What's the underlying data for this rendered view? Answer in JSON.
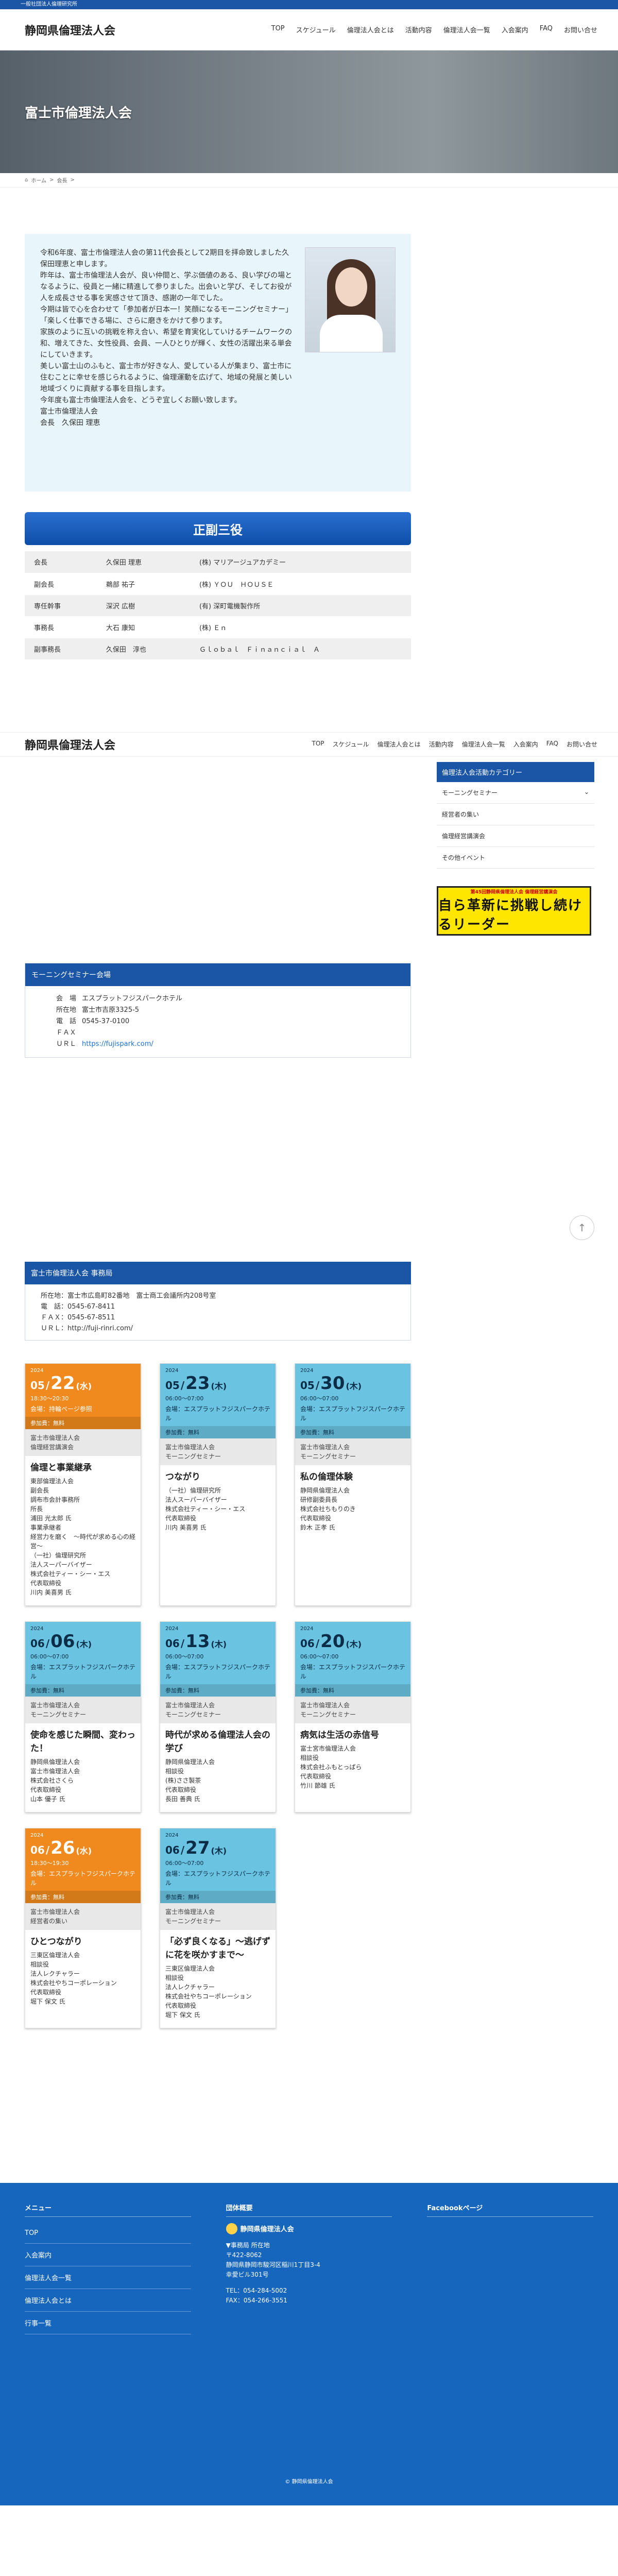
{
  "topbar": {
    "text": "一般社団法人倫理研究所"
  },
  "site": {
    "logo": "静岡県倫理法人会"
  },
  "nav": [
    "TOP",
    "スケジュール",
    "倫理法人会とは",
    "活動内容",
    "倫理法人会一覧",
    "入会案内",
    "FAQ",
    "お問い合せ"
  ],
  "hero": {
    "title": "富士市倫理法人会"
  },
  "breadcrumb": {
    "home": "ホーム",
    "sep": ">",
    "current": "会長"
  },
  "greeting": {
    "lines": [
      "令和6年度、富士市倫理法人会の第11代会長として2期目を拝命致しました久保田理恵と申します。",
      "昨年は、富士市倫理法人会が、良い仲間と、学ぶ価値のある、良い学びの場となるように、役員と一緒に精進して参りました。出会いと学び、そしてお役が人を成長させる事を実感させて頂き、感謝の一年でした。",
      "今期は皆で心を合わせて「参加者が日本一！笑顔になるモーニングセミナー」「楽しく仕事できる場に、さらに磨きをかけて参ります。",
      "家族のように互いの挑戦を称え合い、希望を育実化していけるチームワークの和、増えてきた、女性役員、会員、一人ひとりが輝く、女性の活躍出来る単会にしていきます。",
      "美しい富士山のふもと、富士市が好きな人、愛している人が集まり、富士市に住むことに幸せを感じられるように、倫理運動を広げて、地域の発展と美しい地域づくりに貢献する事を目指します。",
      "今年度も富士市倫理法人会を、どうぞ宜しくお願い致します。",
      "富士市倫理法人会",
      "会長　久保田 理恵"
    ]
  },
  "officers": {
    "banner": "正副三役",
    "rows": [
      {
        "role": "会長",
        "name": "久保田 理恵",
        "company": "(株) マリアージュアカデミー"
      },
      {
        "role": "副会長",
        "name": "鵜部 祐子",
        "company": "(株) ＹＯＵ　ＨＯＵＳＥ"
      },
      {
        "role": "専任幹事",
        "name": "深沢 広樹",
        "company": "(有) 深町電機製作所"
      },
      {
        "role": "事務長",
        "name": "大石 康知",
        "company": "(株) Ｅｎ"
      },
      {
        "role": "副事務長",
        "name": "久保田　淳也",
        "company": "Ｇｌｏｂａｌ　Ｆｉｎａｎｃｉａｌ　Ａ"
      }
    ]
  },
  "sidebar": {
    "title": "倫理法人会活動カテゴリー",
    "items": [
      "モーニングセミナー",
      "経営者の集い",
      "倫理経営講演会",
      "その他イベント"
    ],
    "banner_small": "第45回静岡県倫理法人会 倫理経営講演会",
    "banner_big": "自ら革新に挑戦し続けるリーダー"
  },
  "venue": {
    "title": "モーニングセミナー会場",
    "rows": [
      {
        "k": "会　場",
        "v": "エスプラットフジスパークホテル"
      },
      {
        "k": "所在地",
        "v": "富士市吉原3325-5"
      },
      {
        "k": "電　話",
        "v": "0545-37-0100"
      },
      {
        "k": "ＦＡＸ",
        "v": ""
      },
      {
        "k": "ＵＲＬ",
        "v": "https://fujispark.com/"
      }
    ]
  },
  "office": {
    "title": "富士市倫理法人会 事務局",
    "lines": [
      "所在地：富士市広島町82番地　富士商工会議所内208号室",
      "電　話：0545-67-8411",
      "ＦＡＸ：0545-67-8511",
      "ＵＲＬ：http://fuji-rinri.com/"
    ]
  },
  "events": [
    {
      "year": "2024",
      "month": "05",
      "day": "22",
      "wd": "(水)",
      "time": "18:30～20:30",
      "place": "会場：持輪ページ参照",
      "fee": "参加費：無料",
      "color": "#f08a1e",
      "cat1": "富士市倫理法人会",
      "cat2": "倫理経営講演会",
      "title": "倫理と事業継承",
      "body": [
        "東部倫理法人会",
        "副会長",
        "調布市会計事務所",
        "所長",
        "浦田 光太郎 氏",
        "事業承継者",
        "経営力を磨く　～時代が求める心の経営～",
        "（一社）倫理研究所",
        "法人スーパーバイザー",
        "株式会社ティー・シー・エス",
        "代表取締役",
        "川内 美喜男 氏"
      ]
    },
    {
      "year": "2024",
      "month": "05",
      "day": "23",
      "wd": "(木)",
      "time": "06:00～07:00",
      "place": "会場：エスプラットフジスパークホテル",
      "fee": "参加費：無料",
      "color": "#6ac3e0",
      "cat1": "富士市倫理法人会",
      "cat2": "モーニングセミナー",
      "title": "つながり",
      "body": [
        "（一社）倫理研究所",
        "法人スーパーバイザー",
        "株式会社ティー・シー・エス",
        "代表取締役",
        "川内 美喜男 氏"
      ]
    },
    {
      "year": "2024",
      "month": "05",
      "day": "30",
      "wd": "(木)",
      "time": "06:00～07:00",
      "place": "会場：エスプラットフジスパークホテル",
      "fee": "参加費：無料",
      "color": "#6ac3e0",
      "cat1": "富士市倫理法人会",
      "cat2": "モーニングセミナー",
      "title": "私の倫理体験",
      "body": [
        "静岡県倫理法人会",
        "研修副委員長",
        "株式会社ちもりのき",
        "代表取締役",
        "鈴木 正孝 氏"
      ]
    },
    {
      "year": "2024",
      "month": "06",
      "day": "06",
      "wd": "(木)",
      "time": "06:00～07:00",
      "place": "会場：エスプラットフジスパークホテル",
      "fee": "参加費：無料",
      "color": "#6ac3e0",
      "cat1": "富士市倫理法人会",
      "cat2": "モーニングセミナー",
      "title": "使命を感じた瞬間、変わった！",
      "body": [
        "静岡県倫理法人会",
        "富士市倫理法人会",
        "株式会社さくら",
        "代表取締役",
        "山本 優子 氏"
      ]
    },
    {
      "year": "2024",
      "month": "06",
      "day": "13",
      "wd": "(木)",
      "time": "06:00～07:00",
      "place": "会場：エスプラットフジスパークホテル",
      "fee": "参加費：無料",
      "color": "#6ac3e0",
      "cat1": "富士市倫理法人会",
      "cat2": "モーニングセミナー",
      "title": "時代が求める倫理法人会の学び",
      "body": [
        "静岡県倫理法人会",
        "相談役",
        "(株)ささ製茶",
        "代表取締役",
        "長田 善典 氏"
      ]
    },
    {
      "year": "2024",
      "month": "06",
      "day": "20",
      "wd": "(木)",
      "time": "06:00～07:00",
      "place": "会場：エスプラットフジスパークホテル",
      "fee": "参加費：無料",
      "color": "#6ac3e0",
      "cat1": "富士市倫理法人会",
      "cat2": "モーニングセミナー",
      "title": "病気は生活の赤信号",
      "body": [
        "富士宮市倫理法人会",
        "相談役",
        "株式会社ふもとっぱら",
        "代表取締役",
        "竹川 節雄 氏"
      ]
    },
    {
      "year": "2024",
      "month": "06",
      "day": "26",
      "wd": "(水)",
      "time": "18:30～19:30",
      "place": "会場：エスプラットフジスパークホテル",
      "fee": "参加費：無料",
      "color": "#f08a1e",
      "cat1": "富士市倫理法人会",
      "cat2": "経営者の集い",
      "title": "ひとつながり",
      "body": [
        "三東区倫理法人会",
        "相談役",
        "法人レクチャラー",
        "株式会社やちコーポレーション",
        "代表取締役",
        "堀下 保文 氏"
      ]
    },
    {
      "year": "2024",
      "month": "06",
      "day": "27",
      "wd": "(木)",
      "time": "06:00～07:00",
      "place": "会場：エスプラットフジスパークホテル",
      "fee": "参加費：無料",
      "color": "#6ac3e0",
      "cat1": "富士市倫理法人会",
      "cat2": "モーニングセミナー",
      "title": "「必ず良くなる」～逃げずに花を咲かすまで～",
      "body": [
        "三東区倫理法人会",
        "相談役",
        "法人レクチャラー",
        "株式会社やちコーポレーション",
        "代表取締役",
        "堀下 保文 氏"
      ]
    }
  ],
  "footer": {
    "menu_title": "メニュー",
    "menu": [
      "TOP",
      "入会案内",
      "倫理法人会一覧",
      "倫理法人会とは",
      "行事一覧"
    ],
    "info_title": "団体概要",
    "org_name": "静岡県倫理法人会",
    "org_lines": [
      "▼事務局 所在地",
      "〒422-8062",
      "静岡県静岡市駿河区稲川1丁目3-4",
      "幸愛ビル301号",
      "",
      "TEL：054-284-5002",
      "FAX：054-266-3551"
    ],
    "fb_title": "Facebookページ",
    "copyright": "© 静岡県倫理法人会"
  }
}
